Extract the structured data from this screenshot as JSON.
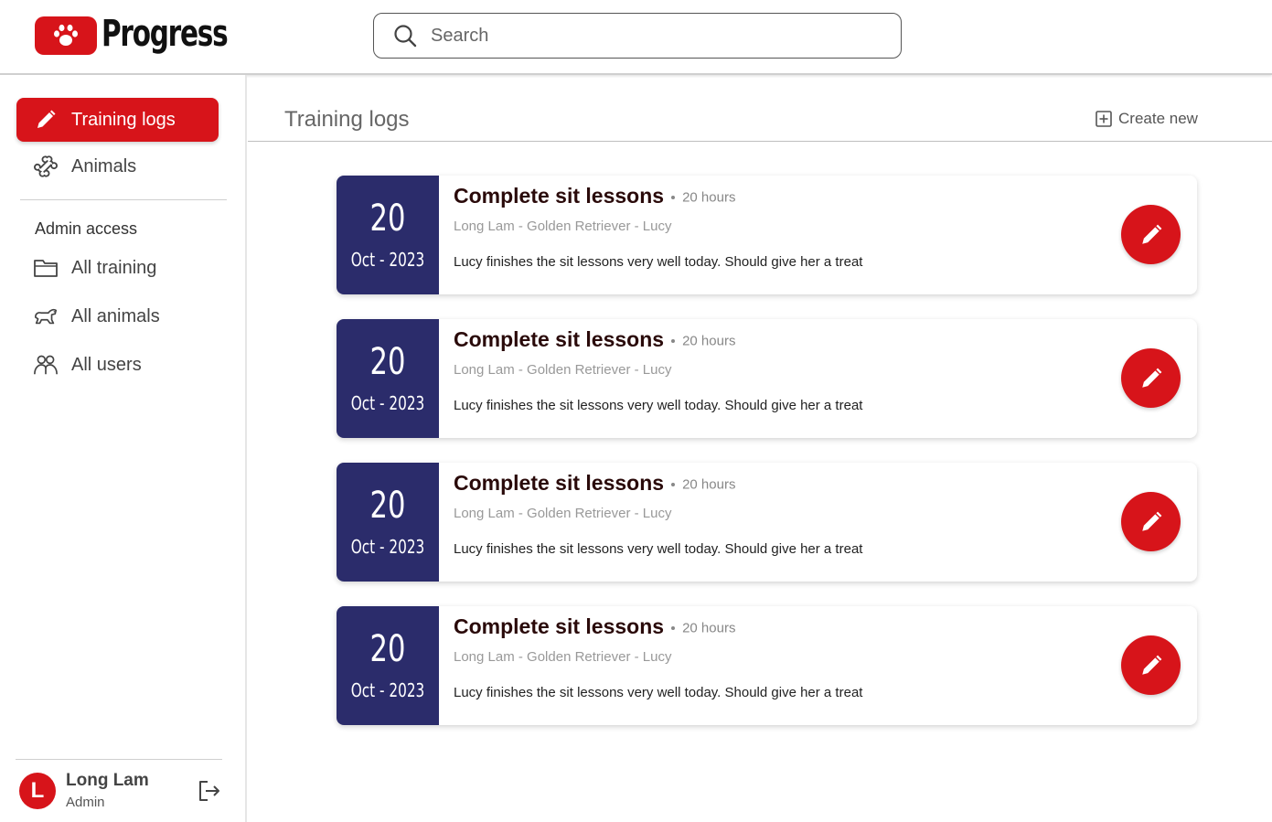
{
  "header": {
    "logo_text": "Progress",
    "search_placeholder": "Search",
    "brand_color": "#d7141a"
  },
  "sidebar": {
    "items": [
      {
        "label": "Training logs",
        "icon": "pencil-icon",
        "active": true
      },
      {
        "label": "Animals",
        "icon": "bone-icon",
        "active": false
      }
    ],
    "admin_title": "Admin access",
    "admin_items": [
      {
        "label": "All training",
        "icon": "folder-icon"
      },
      {
        "label": "All animals",
        "icon": "dog-icon"
      },
      {
        "label": "All users",
        "icon": "users-icon"
      }
    ],
    "user": {
      "initial": "L",
      "name": "Long Lam",
      "role": "Admin"
    }
  },
  "main": {
    "title": "Training logs",
    "create_label": "Create new",
    "logs": [
      {
        "day": "20",
        "month_year": "Oct - 2023",
        "title": "Complete sit lessons",
        "hours": "20 hours",
        "meta": "Long Lam - Golden Retriever - Lucy",
        "description": "Lucy finishes the sit lessons very well today. Should give her a treat"
      },
      {
        "day": "20",
        "month_year": "Oct - 2023",
        "title": "Complete sit lessons",
        "hours": "20 hours",
        "meta": "Long Lam - Golden Retriever - Lucy",
        "description": "Lucy finishes the sit lessons very well today. Should give her a treat"
      },
      {
        "day": "20",
        "month_year": "Oct - 2023",
        "title": "Complete sit lessons",
        "hours": "20 hours",
        "meta": "Long Lam - Golden Retriever - Lucy",
        "description": "Lucy finishes the sit lessons very well today. Should give her a treat"
      },
      {
        "day": "20",
        "month_year": "Oct - 2023",
        "title": "Complete sit lessons",
        "hours": "20 hours",
        "meta": "Long Lam - Golden Retriever - Lucy",
        "description": "Lucy finishes the sit lessons very well today. Should give her a treat"
      }
    ]
  }
}
